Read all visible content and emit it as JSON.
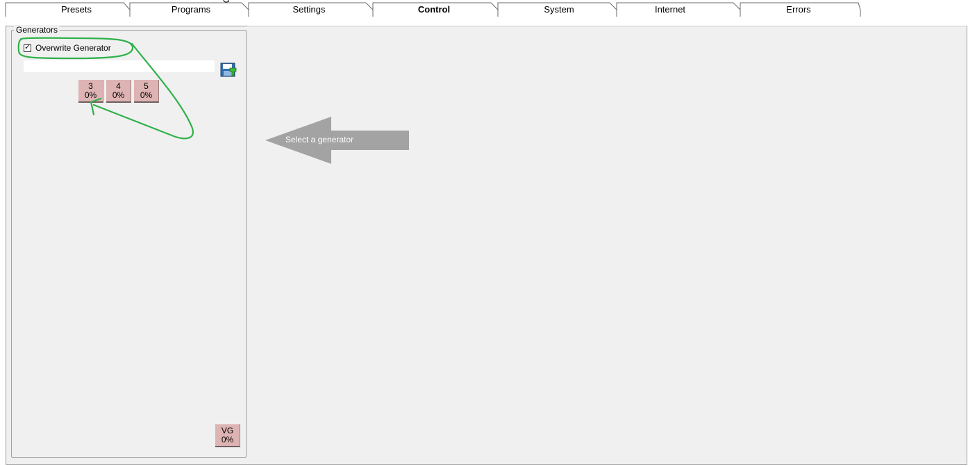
{
  "tabs": [
    {
      "label": "Presets",
      "active": false
    },
    {
      "label": "Programs",
      "active": false
    },
    {
      "label": "Settings",
      "active": false
    },
    {
      "label": "Control",
      "active": true
    },
    {
      "label": "System",
      "active": false
    },
    {
      "label": "Internet",
      "active": false
    },
    {
      "label": "Errors",
      "active": false
    }
  ],
  "generators_group": {
    "title": "Generators",
    "overwrite_checkbox": {
      "label": "Overwrite Generator",
      "checked": true,
      "mark": "✓"
    },
    "name_input": {
      "value": "",
      "placeholder": ""
    },
    "save_icon": "save-disk-icon",
    "buttons": [
      {
        "id": "3",
        "value": "0%"
      },
      {
        "id": "4",
        "value": "0%"
      },
      {
        "id": "5",
        "value": "0%"
      }
    ],
    "vg_button": {
      "id": "VG",
      "value": "0%"
    }
  },
  "hint": {
    "text": "Select a generator",
    "icon": "left-arrow-icon"
  },
  "colors": {
    "generator_button": "#deb3b3",
    "annotation": "#2fb14a",
    "hint_arrow": "#a3a3a3",
    "background": "#f0f0f0"
  }
}
